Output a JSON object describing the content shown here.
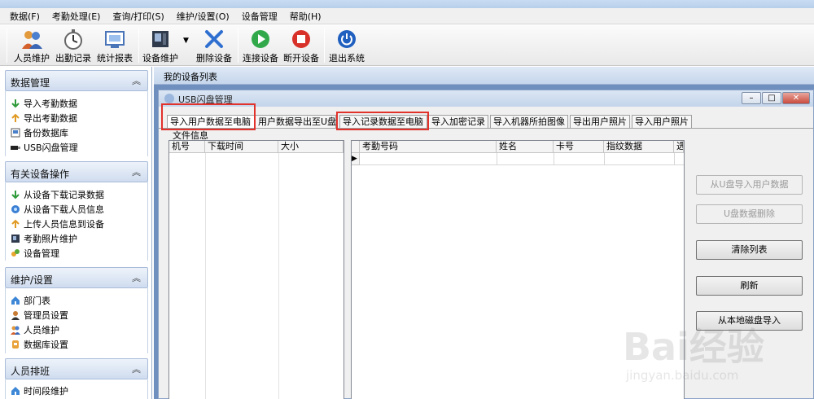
{
  "menu": [
    "数据(F)",
    "考勤处理(E)",
    "查询/打印(S)",
    "维护/设置(O)",
    "设备管理",
    "帮助(H)"
  ],
  "toolbar": {
    "staff": "人员维护",
    "attendance": "出勤记录",
    "report": "统计报表",
    "device_maint": "设备维护",
    "delete_device": "删除设备",
    "connect": "连接设备",
    "disconnect": "断开设备",
    "exit": "退出系统"
  },
  "sidebar": {
    "data_mgmt": {
      "title": "数据管理",
      "items": [
        "导入考勤数据",
        "导出考勤数据",
        "备份数据库",
        "USB闪盘管理"
      ]
    },
    "device_ops": {
      "title": "有关设备操作",
      "items": [
        "从设备下载记录数据",
        "从设备下载人员信息",
        "上传人员信息到设备",
        "考勤照片维护",
        "设备管理"
      ]
    },
    "settings": {
      "title": "维护/设置",
      "items": [
        "部门表",
        "管理员设置",
        "人员维护",
        "数据库设置"
      ]
    },
    "schedule": {
      "title": "人员排班",
      "items": [
        "时间段维护"
      ]
    }
  },
  "main": {
    "header": "我的设备列表"
  },
  "window": {
    "title": "USB闪盘管理",
    "tabs": [
      "导入用户数据至电脑",
      "用户数据导出至U盘",
      "导入记录数据至电脑",
      "导入加密记录",
      "导入机器所拍图像",
      "导出用户照片",
      "导入用户照片"
    ],
    "file_info_label": "文件信息",
    "left_columns": [
      "机号",
      "下载时间",
      "大小"
    ],
    "right_columns": [
      "考勤号码",
      "姓名",
      "卡号",
      "指纹数据",
      "选"
    ],
    "buttons": {
      "import_from_u": "从U盘导入用户数据",
      "delete_u": "U盘数据删除",
      "clear": "清除列表",
      "refresh": "刷新",
      "import_local": "从本地磁盘导入"
    }
  },
  "watermark": {
    "brand": "Bai经验",
    "url": "jingyan.baidu.com"
  }
}
